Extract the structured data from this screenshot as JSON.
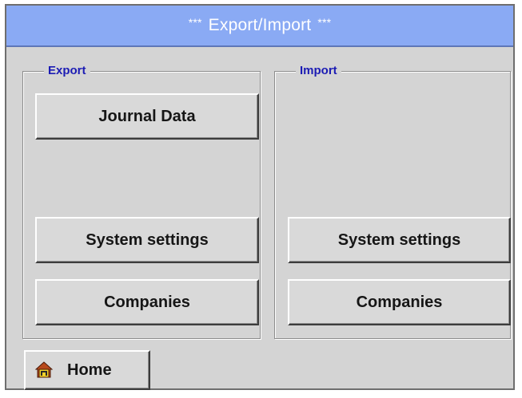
{
  "window": {
    "title_prefix": "***",
    "title": "Export/Import",
    "title_suffix": "***"
  },
  "export": {
    "legend": "Export",
    "journal_data_label": "Journal Data",
    "system_settings_label": "System settings",
    "companies_label": "Companies"
  },
  "import": {
    "legend": "Import",
    "system_settings_label": "System settings",
    "companies_label": "Companies"
  },
  "footer": {
    "home_label": "Home",
    "home_icon": "home-icon"
  },
  "colors": {
    "titlebar": "#8aaaf4",
    "legend_text": "#1c1cb4",
    "background": "#d4d4d4"
  }
}
